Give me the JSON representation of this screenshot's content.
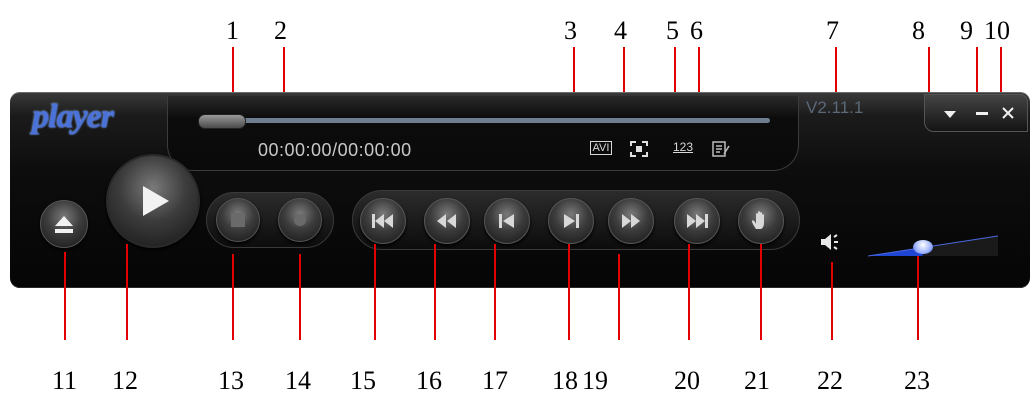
{
  "annotations": [
    "1",
    "2",
    "3",
    "4",
    "5",
    "6",
    "7",
    "8",
    "9",
    "10",
    "11",
    "12",
    "13",
    "14",
    "15",
    "16",
    "17",
    "18",
    "19",
    "20",
    "21",
    "22",
    "23"
  ],
  "player": {
    "logo": "player",
    "time_display": "00:00:00/00:00:00",
    "version": "V2.11.1",
    "format_badge": "AVI",
    "subtitle_badge": "123",
    "progress_fraction": 0.0,
    "volume_fraction": 0.42,
    "colors": {
      "logo": "#4a72d8",
      "volume": "#1e46d2",
      "leader": "#e00000"
    }
  },
  "controls": [
    {
      "name": "eject-button",
      "icon": "eject-icon"
    },
    {
      "name": "play-button",
      "icon": "play-icon"
    },
    {
      "name": "stop-button",
      "icon": "stop-icon"
    },
    {
      "name": "record-button",
      "icon": "record-icon"
    },
    {
      "name": "first-button",
      "icon": "skip-first-icon"
    },
    {
      "name": "rewind-button",
      "icon": "rewind-icon"
    },
    {
      "name": "previous-frame-button",
      "icon": "previous-frame-icon"
    },
    {
      "name": "next-frame-button",
      "icon": "next-frame-icon"
    },
    {
      "name": "fast-forward-button",
      "icon": "fast-forward-icon"
    },
    {
      "name": "last-button",
      "icon": "skip-last-icon"
    },
    {
      "name": "capture-button",
      "icon": "hand-icon"
    }
  ],
  "window_buttons": [
    {
      "name": "menu-button",
      "icon": "dropdown-icon"
    },
    {
      "name": "minimize-button",
      "icon": "minimize-icon"
    },
    {
      "name": "close-button",
      "icon": "close-icon"
    }
  ]
}
